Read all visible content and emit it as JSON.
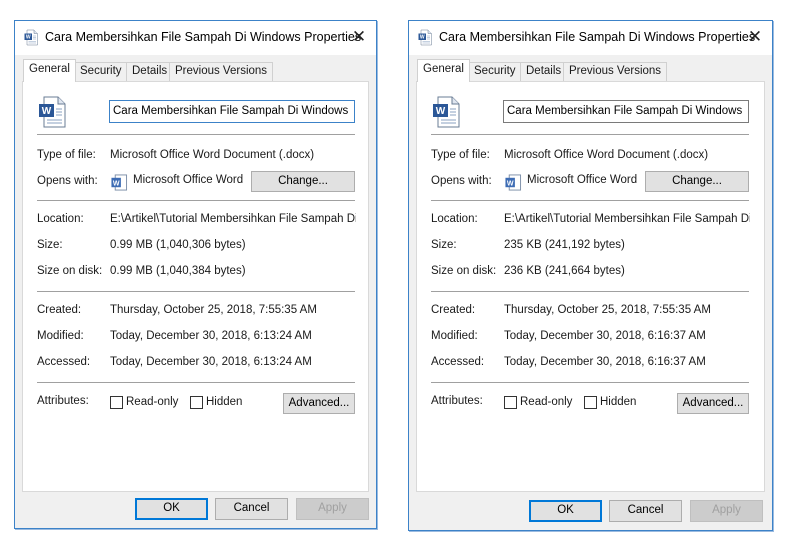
{
  "dialogs": [
    {
      "title": "Cara Membersihkan File Sampah Di Windows Properties",
      "tabs": [
        "General",
        "Security",
        "Details",
        "Previous Versions"
      ],
      "file_name": "Cara Membersihkan File Sampah Di Windows",
      "type_label": "Type of file:",
      "type_value": "Microsoft Office Word Document (.docx)",
      "opens_label": "Opens with:",
      "opens_value": "Microsoft Office Word",
      "change_label": "Change...",
      "location_label": "Location:",
      "location_value": "E:\\Artikel\\Tutorial Membersihkan File Sampah Di Wi",
      "size_label": "Size:",
      "size_value": "0.99 MB (1,040,306 bytes)",
      "size_disk_label": "Size on disk:",
      "size_disk_value": "0.99 MB (1,040,384 bytes)",
      "created_label": "Created:",
      "created_value": "Thursday, October 25, 2018, 7:55:35 AM",
      "modified_label": "Modified:",
      "modified_value": "Today, December 30, 2018, 6:13:24 AM",
      "accessed_label": "Accessed:",
      "accessed_value": "Today, December 30, 2018, 6:13:24 AM",
      "attributes_label": "Attributes:",
      "readonly_label": "Read-only",
      "hidden_label": "Hidden",
      "advanced_label": "Advanced...",
      "ok_label": "OK",
      "cancel_label": "Cancel",
      "apply_label": "Apply"
    },
    {
      "title": "Cara Membersihkan File Sampah Di Windows Properties",
      "tabs": [
        "General",
        "Security",
        "Details",
        "Previous Versions"
      ],
      "file_name": "Cara Membersihkan File Sampah Di Windows",
      "type_label": "Type of file:",
      "type_value": "Microsoft Office Word Document (.docx)",
      "opens_label": "Opens with:",
      "opens_value": "Microsoft Office Word",
      "change_label": "Change...",
      "location_label": "Location:",
      "location_value": "E:\\Artikel\\Tutorial Membersihkan File Sampah Di Wi",
      "size_label": "Size:",
      "size_value": "235 KB (241,192 bytes)",
      "size_disk_label": "Size on disk:",
      "size_disk_value": "236 KB (241,664 bytes)",
      "created_label": "Created:",
      "created_value": "Thursday, October 25, 2018, 7:55:35 AM",
      "modified_label": "Modified:",
      "modified_value": "Today, December 30, 2018, 6:16:37 AM",
      "accessed_label": "Accessed:",
      "accessed_value": "Today, December 30, 2018, 6:16:37 AM",
      "attributes_label": "Attributes:",
      "readonly_label": "Read-only",
      "hidden_label": "Hidden",
      "advanced_label": "Advanced...",
      "ok_label": "OK",
      "cancel_label": "Cancel",
      "apply_label": "Apply"
    }
  ],
  "icons": {
    "title": "word-document-icon",
    "file": "word-document-icon",
    "app": "word-app-icon",
    "close": "close-icon"
  },
  "colors": {
    "accent": "#0078d7",
    "window_border": "#3c82c8",
    "dialog_bg": "#f0f0f0",
    "panel_bg": "#ffffff"
  }
}
